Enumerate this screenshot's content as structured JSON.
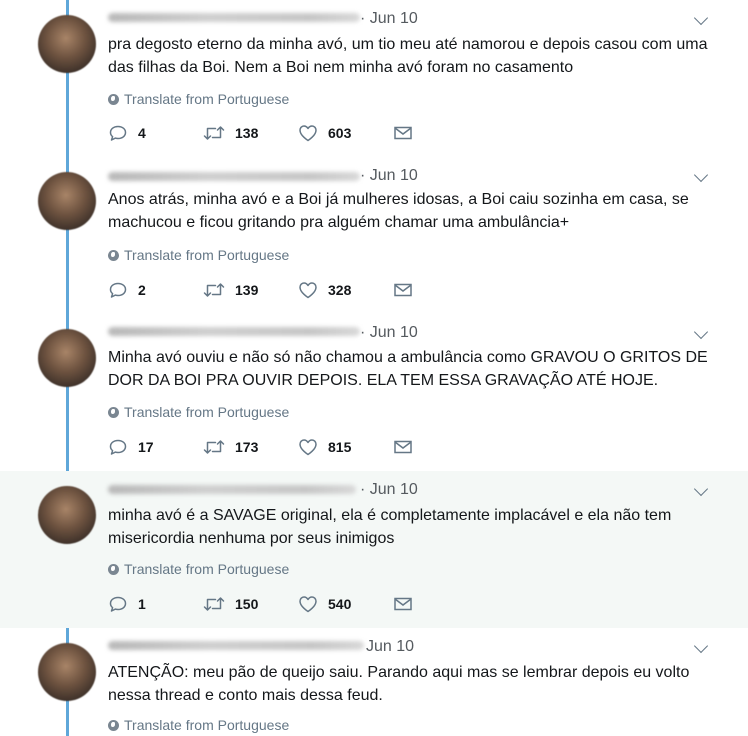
{
  "tweets": [
    {
      "date": "· Jun 10",
      "text": "pra degosto eterno da minha avó, um tio meu até namorou e depois casou com uma das filhas da Boi. Nem a Boi nem minha avó foram no casamento",
      "translate": "Translate from Portuguese",
      "replies": "4",
      "retweets": "138",
      "likes": "603",
      "highlighted": false
    },
    {
      "date": "· Jun 10",
      "text": "Anos atrás, minha avó e a Boi já mulheres idosas, a Boi caiu sozinha em casa, se machucou e ficou gritando pra alguém chamar uma ambulância+",
      "translate": "Translate from Portuguese",
      "replies": "2",
      "retweets": "139",
      "likes": "328",
      "highlighted": false
    },
    {
      "date": "· Jun 10",
      "text": "Minha avó ouviu e não só não chamou a ambulância como GRAVOU O GRITOS DE DOR DA BOI PRA OUVIR DEPOIS. ELA TEM ESSA GRAVAÇÃO ATÉ HOJE.",
      "translate": "Translate from Portuguese",
      "replies": "17",
      "retweets": "173",
      "likes": "815",
      "highlighted": false
    },
    {
      "date": "· Jun 10",
      "text": "minha avó é a SAVAGE original, ela é completamente implacável e ela não tem misericordia nenhuma por seus inimigos",
      "translate": "Translate from Portuguese",
      "replies": "1",
      "retweets": "150",
      "likes": "540",
      "highlighted": true
    },
    {
      "date": "Jun 10",
      "text": "ATENÇÃO: meu pão de queijo saiu. Parando aqui mas se lembrar depois eu volto nessa thread e conto mais dessa feud.",
      "translate": "Translate from Portuguese",
      "highlighted": false
    }
  ]
}
